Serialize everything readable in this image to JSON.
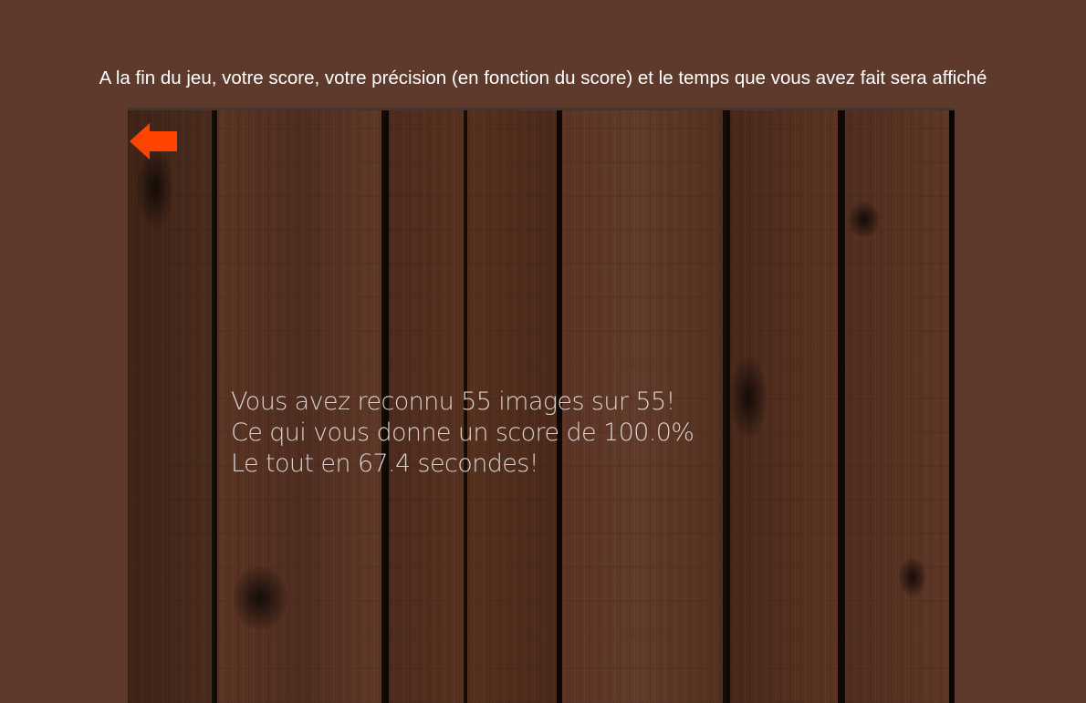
{
  "caption": "A la fin du jeu, votre score, votre précision (en fonction du score) et le temps que vous avez fait sera affiché",
  "game": {
    "back_icon": "left-arrow-icon",
    "accent_color": "#ff4500",
    "results": {
      "line1": "Vous avez reconnu 55 images sur 55!",
      "line2": "Ce qui vous donne un score de 100.0%",
      "line3": "Le tout en 67.4 secondes!"
    }
  }
}
